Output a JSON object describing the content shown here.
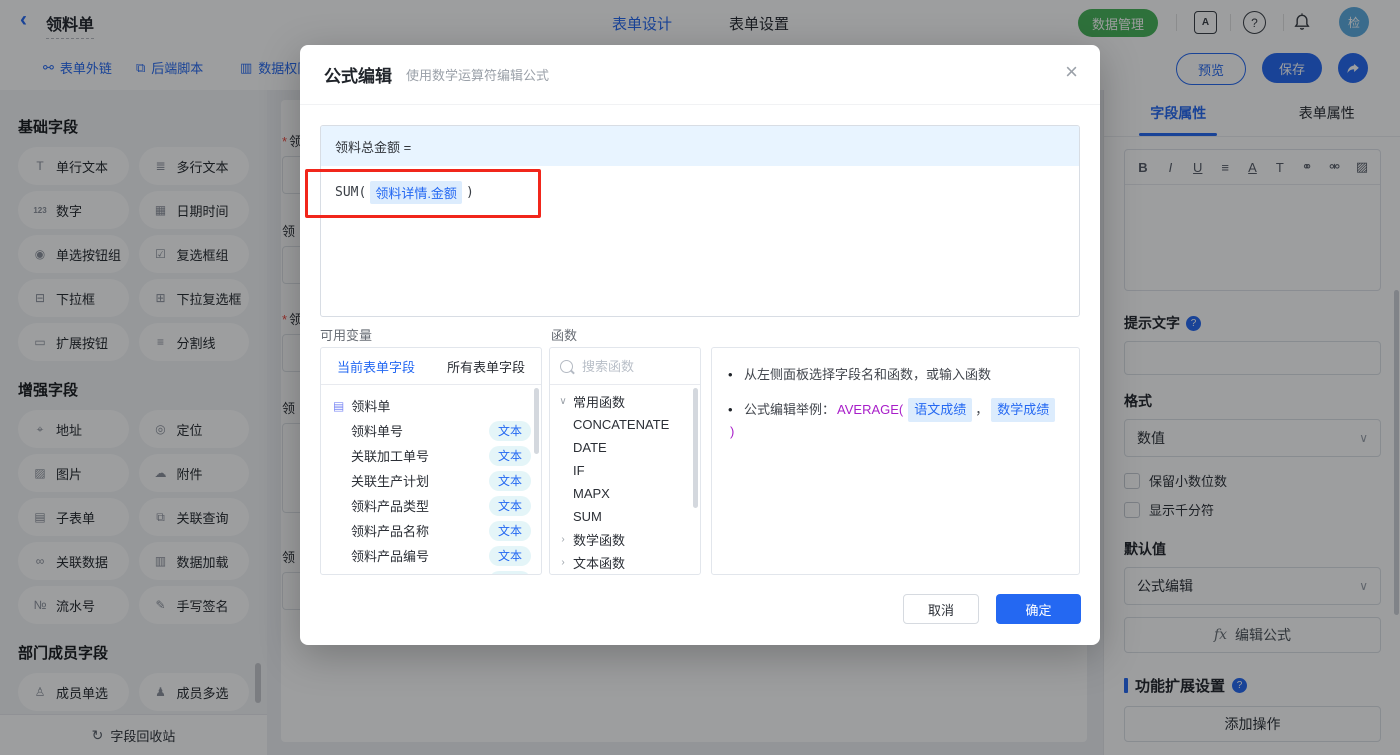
{
  "colors": {
    "accent": "#2468f2",
    "green": "#47b559",
    "annotation_red": "#f1261b",
    "token_bg": "#dcecfd",
    "tag_bg": "#e4f5f8",
    "band_bg": "#e8f4ff",
    "example_purple": "#a81ec9"
  },
  "icons": {
    "back": "‹",
    "close": "×",
    "chevron_down": "∨",
    "expander_open": "∨",
    "expander_collapsed": "›",
    "bullet": "•",
    "question": "?",
    "docs_a": "A",
    "recycle": "↻",
    "doc": "▤"
  },
  "topbar": {
    "title": "领料单",
    "tabs": [
      {
        "label": "表单设计"
      },
      {
        "label": "表单设置"
      }
    ],
    "data_manage": "数据管理",
    "avatar": "检"
  },
  "toolbar": {
    "items": [
      {
        "glyph": "⚯",
        "label": "表单外链"
      },
      {
        "glyph": "⧉",
        "label": "后端脚本"
      },
      {
        "glyph": "▥",
        "label": "数据权限"
      }
    ],
    "preview": "预览",
    "save": "保存"
  },
  "sidebar": {
    "sections": [
      {
        "title": "基础字段",
        "fields": [
          {
            "glyph": "T",
            "label": "单行文本"
          },
          {
            "glyph": "≣",
            "label": "多行文本"
          },
          {
            "glyph": "123",
            "label": "数字"
          },
          {
            "glyph": "▦",
            "label": "日期时间"
          },
          {
            "glyph": "◉",
            "label": "单选按钮组"
          },
          {
            "glyph": "☑",
            "label": "复选框组"
          },
          {
            "glyph": "⊟",
            "label": "下拉框"
          },
          {
            "glyph": "⊞",
            "label": "下拉复选框"
          },
          {
            "glyph": "▭",
            "label": "扩展按钮"
          },
          {
            "glyph": "≡",
            "label": "分割线"
          }
        ]
      },
      {
        "title": "增强字段",
        "fields": [
          {
            "glyph": "⌖",
            "label": "地址"
          },
          {
            "glyph": "◎",
            "label": "定位"
          },
          {
            "glyph": "▨",
            "label": "图片"
          },
          {
            "glyph": "☁",
            "label": "附件"
          },
          {
            "glyph": "▤",
            "label": "子表单"
          },
          {
            "glyph": "⧉",
            "label": "关联查询"
          },
          {
            "glyph": "∞",
            "label": "关联数据"
          },
          {
            "glyph": "▥",
            "label": "数据加载"
          },
          {
            "glyph": "№",
            "label": "流水号"
          },
          {
            "glyph": "✎",
            "label": "手写签名"
          }
        ]
      },
      {
        "title": "部门成员字段",
        "fields": [
          {
            "glyph": "♙",
            "label": "成员单选"
          },
          {
            "glyph": "♟",
            "label": "成员多选"
          }
        ]
      }
    ],
    "recycle_label": "字段回收站"
  },
  "canvas": {
    "required_mark": "*",
    "fields": [
      {
        "required": true,
        "label": "领"
      },
      {
        "required": false,
        "label": "领"
      },
      {
        "required": true,
        "label": "领"
      },
      {
        "required": false,
        "label": "领"
      },
      {
        "required": false,
        "label": "领"
      }
    ]
  },
  "modal": {
    "title": "公式编辑",
    "subtitle": "使用数学运算符编辑公式",
    "formula_target": "领料总金额 =",
    "formula": {
      "fn_open": "SUM(",
      "token": "领料详情.金额",
      "fn_close": ")"
    },
    "variables": {
      "label": "可用变量",
      "tab_current": "当前表单字段",
      "tab_all": "所有表单字段",
      "root": "领料单",
      "fields": [
        {
          "name": "领料单号",
          "tag": "文本"
        },
        {
          "name": "关联加工单号",
          "tag": "文本"
        },
        {
          "name": "关联生产计划",
          "tag": "文本"
        },
        {
          "name": "领料产品类型",
          "tag": "文本"
        },
        {
          "name": "领料产品名称",
          "tag": "文本"
        },
        {
          "name": "领料产品编号",
          "tag": "文本"
        }
      ],
      "partial_tag": "文本"
    },
    "functions": {
      "label": "函数",
      "search_placeholder": "搜索函数",
      "group_common": "常用函数",
      "items": [
        "CONCATENATE",
        "DATE",
        "IF",
        "MAPX",
        "SUM"
      ],
      "group_math": "数学函数",
      "group_text": "文本函数"
    },
    "help": {
      "line1": "从左侧面板选择字段名和函数，或输入函数",
      "line2_prefix": "公式编辑举例：",
      "fn_open": "AVERAGE(",
      "token1": "语文成绩",
      "comma": "，",
      "token2": "数学成绩",
      "fn_close": ")"
    },
    "cancel": "取消",
    "confirm": "确定"
  },
  "properties": {
    "tab_field": "字段属性",
    "tab_form": "表单属性",
    "richtext_tools": [
      {
        "name": "bold",
        "glyph": "B"
      },
      {
        "name": "italic",
        "glyph": "I"
      },
      {
        "name": "underline",
        "glyph": "U"
      },
      {
        "name": "align",
        "glyph": "≡"
      },
      {
        "name": "font-color",
        "glyph": "A"
      },
      {
        "name": "font-size",
        "glyph": "T"
      },
      {
        "name": "link",
        "glyph": "⚭"
      },
      {
        "name": "unlink",
        "glyph": "⚮"
      },
      {
        "name": "image",
        "glyph": "▨"
      }
    ],
    "hint_label": "提示文字",
    "format_label": "格式",
    "format_value": "数值",
    "cb_decimal": "保留小数位数",
    "cb_thousand": "显示千分符",
    "default_label": "默认值",
    "default_value": "公式编辑",
    "fx": "fx",
    "edit_formula": "编辑公式",
    "ext_label": "功能扩展设置",
    "add_action": "添加操作"
  }
}
